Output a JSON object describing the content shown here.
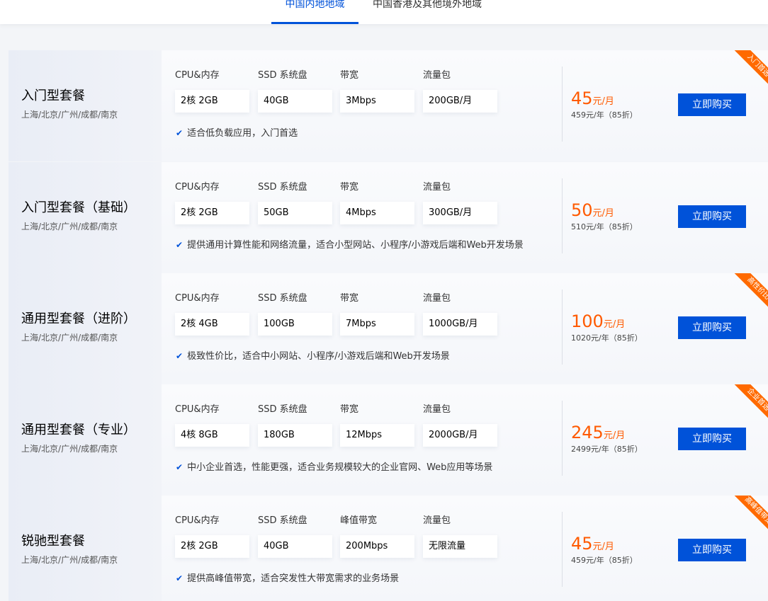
{
  "tabs": [
    {
      "label": "中国内地地域",
      "active": true
    },
    {
      "label": "中国香港及其他境外地域",
      "active": false
    }
  ],
  "colors": {
    "accent": "#0052d9",
    "price": "#ff5a00",
    "ribbon": "#ff6a00"
  },
  "icons": {
    "check": "check-icon"
  },
  "plans": [
    {
      "name": "入门型套餐",
      "region": "上海/北京/广州/成都/南京",
      "specs": [
        {
          "label": "CPU&内存",
          "value": "2核 2GB"
        },
        {
          "label": "SSD 系统盘",
          "value": "40GB"
        },
        {
          "label": "带宽",
          "value": "3Mbps"
        },
        {
          "label": "流量包",
          "value": "200GB/月"
        }
      ],
      "desc": "适合低负载应用，入门首选",
      "price": "45",
      "price_unit": "元/月",
      "price_year": "459元/年（85折）",
      "buy_label": "立即购买",
      "ribbon": "入门首选"
    },
    {
      "name": "入门型套餐（基础）",
      "region": "上海/北京/广州/成都/南京",
      "specs": [
        {
          "label": "CPU&内存",
          "value": "2核 2GB"
        },
        {
          "label": "SSD 系统盘",
          "value": "50GB"
        },
        {
          "label": "带宽",
          "value": "4Mbps"
        },
        {
          "label": "流量包",
          "value": "300GB/月"
        }
      ],
      "desc": "提供通用计算性能和网络流量，适合小型网站、小程序/小游戏后端和Web开发场景",
      "price": "50",
      "price_unit": "元/月",
      "price_year": "510元/年（85折）",
      "buy_label": "立即购买",
      "ribbon": ""
    },
    {
      "name": "通用型套餐（进阶）",
      "region": "上海/北京/广州/成都/南京",
      "specs": [
        {
          "label": "CPU&内存",
          "value": "2核 4GB"
        },
        {
          "label": "SSD 系统盘",
          "value": "100GB"
        },
        {
          "label": "带宽",
          "value": "7Mbps"
        },
        {
          "label": "流量包",
          "value": "1000GB/月"
        }
      ],
      "desc": "极致性价比，适合中小网站、小程序/小游戏后端和Web开发场景",
      "price": "100",
      "price_unit": "元/月",
      "price_year": "1020元/年（85折）",
      "buy_label": "立即购买",
      "ribbon": "高性价比"
    },
    {
      "name": "通用型套餐（专业）",
      "region": "上海/北京/广州/成都/南京",
      "specs": [
        {
          "label": "CPU&内存",
          "value": "4核 8GB"
        },
        {
          "label": "SSD 系统盘",
          "value": "180GB"
        },
        {
          "label": "带宽",
          "value": "12Mbps"
        },
        {
          "label": "流量包",
          "value": "2000GB/月"
        }
      ],
      "desc": "中小企业首选，性能更强，适合业务规模较大的企业官网、Web应用等场景",
      "price": "245",
      "price_unit": "元/月",
      "price_year": "2499元/年（85折）",
      "buy_label": "立即购买",
      "ribbon": "企业首选"
    },
    {
      "name": "锐驰型套餐",
      "region": "上海/北京/广州/成都/南京",
      "specs": [
        {
          "label": "CPU&内存",
          "value": "2核 2GB"
        },
        {
          "label": "SSD 系统盘",
          "value": "40GB"
        },
        {
          "label": "峰值带宽",
          "value": "200Mbps"
        },
        {
          "label": "流量包",
          "value": "无限流量"
        }
      ],
      "desc": "提供高峰值带宽，适合突发性大带宽需求的业务场景",
      "price": "45",
      "price_unit": "元/月",
      "price_year": "459元/年（85折）",
      "buy_label": "立即购买",
      "ribbon": "高峰值带宽"
    }
  ]
}
